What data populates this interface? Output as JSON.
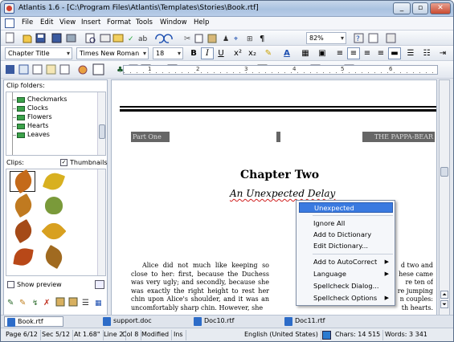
{
  "title": "Atlantis 1.6 - [C:\\Program Files\\Atlantis\\Templates\\Stories\\Book.rtf]",
  "window_buttons": [
    "_",
    "▫",
    "✕"
  ],
  "menu": [
    "File",
    "Edit",
    "View",
    "Insert",
    "Format",
    "Tools",
    "Window",
    "Help"
  ],
  "zoom": "82%",
  "format": {
    "style": "Chapter Title",
    "font": "Times New Roman",
    "size": "18"
  },
  "clip_panel": {
    "folders_label": "Clip folders:",
    "folders": [
      "Checkmarks",
      "Clocks",
      "Flowers",
      "Hearts",
      "Leaves"
    ],
    "clips_label": "Clips:",
    "thumbnails_label": "Thumbnails",
    "show_preview_label": "Show preview"
  },
  "document": {
    "header_left": "Part One",
    "header_right": "THE PAPPA-BEAR",
    "chapter_title": "Chapter Two",
    "subtitle": "An Unexpected Delay",
    "col1": "Alice did not much like keeping so close to her: first, because the Duchess was very ugly; and secondly, because she was exactly the right height to rest her chin upon Alice's shoulder, and it was an uncomfortably sharp chin. However, she",
    "col2": [
      " d two and",
      "hese came",
      "re ten of",
      "re jumping",
      "n couples:",
      "th hearts."
    ]
  },
  "context_menu": {
    "suggestion": "Unexpected",
    "items": [
      "Ignore All",
      "Add to Dictionary",
      "Edit Dictionary...",
      "Add to AutoCorrect",
      "Language",
      "Spellcheck Dialog...",
      "Spellcheck Options"
    ]
  },
  "tabs": [
    "Book.rtf",
    "support.doc",
    "Doc10.rtf",
    "Doc11.rtf"
  ],
  "status": {
    "page": "Page 6/12",
    "sec": "Sec 5/12",
    "pos": "At 1.68\"",
    "line": "Line 2",
    "col": "Col 8",
    "modified": "Modified",
    "ins": "Ins",
    "lang": "English (United States)",
    "chars": "Chars: 14 515",
    "words": "Words: 3 341"
  },
  "colors": {
    "accent": "#3a7ae0",
    "titlebar": "#aac2e0",
    "leaf_orange": "#d07a1a",
    "leaf_green": "#7a9a2a"
  }
}
